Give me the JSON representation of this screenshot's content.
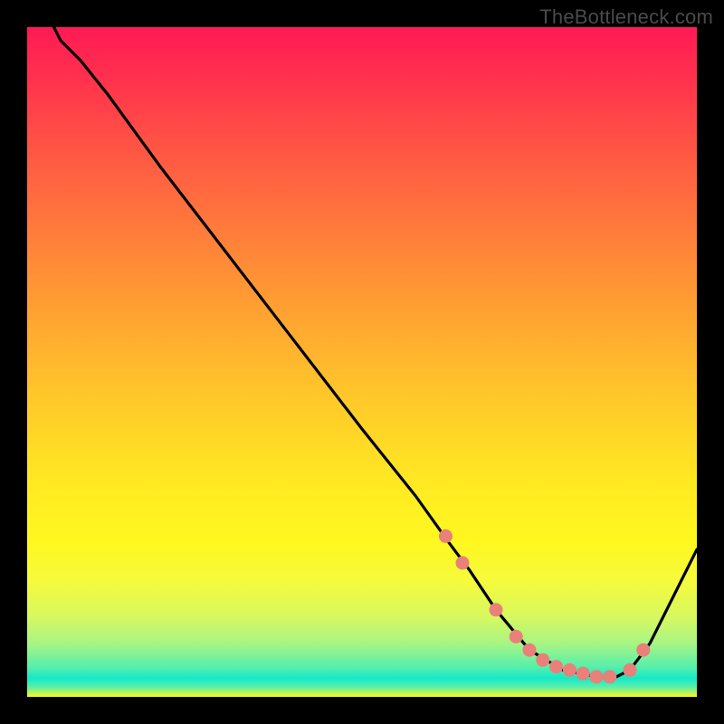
{
  "attribution": "TheBottleneck.com",
  "chart_data": {
    "type": "line",
    "title": "",
    "xlabel": "",
    "ylabel": "",
    "x_range": [
      0,
      100
    ],
    "y_range": [
      0,
      100
    ],
    "series": [
      {
        "name": "curve",
        "x": [
          4,
          5,
          8,
          12,
          20,
          30,
          40,
          50,
          58,
          63,
          66,
          70,
          75,
          80,
          85,
          88,
          90,
          93,
          96,
          100
        ],
        "y": [
          100,
          98,
          95,
          90,
          79,
          66,
          53,
          40,
          30,
          23,
          19,
          13,
          7,
          4,
          3,
          3,
          4,
          8,
          14,
          22
        ]
      }
    ],
    "markers": {
      "name": "highlighted-points",
      "color": "#e98079",
      "x": [
        62.5,
        65,
        70,
        73,
        75,
        77,
        79,
        81,
        83,
        85,
        87,
        90,
        92
      ],
      "y": [
        24,
        20,
        13,
        9,
        7,
        5.5,
        4.5,
        4,
        3.5,
        3,
        3,
        4,
        7
      ]
    },
    "colors": {
      "curve_stroke": "#000000",
      "marker_fill": "#e98079",
      "gradient_top": "#ff1a55",
      "gradient_mid": "#ffe922",
      "gradient_bottom": "#14e9c9"
    }
  }
}
